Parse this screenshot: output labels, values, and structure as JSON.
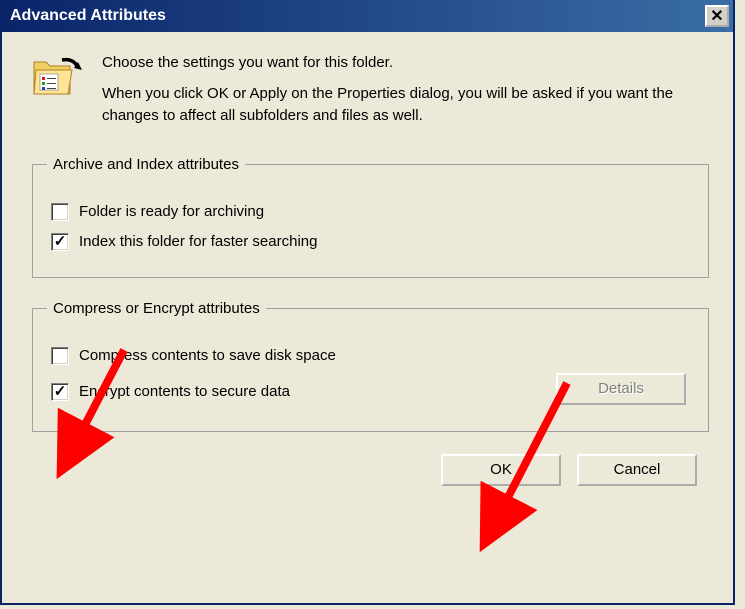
{
  "window": {
    "title": "Advanced Attributes"
  },
  "header": {
    "line1": "Choose the settings you want for this folder.",
    "line2": "When you click OK or Apply on the Properties dialog, you will be asked if you want the changes to affect all subfolders and files as well."
  },
  "groups": {
    "archive": {
      "legend": "Archive and Index attributes",
      "items": [
        {
          "label": "Folder is ready for archiving",
          "checked": false
        },
        {
          "label": "Index this folder for faster searching",
          "checked": true
        }
      ]
    },
    "compress": {
      "legend": "Compress or Encrypt attributes",
      "items": [
        {
          "label": "Compress contents to save disk space",
          "checked": false
        },
        {
          "label": "Encrypt contents to secure data",
          "checked": true
        }
      ],
      "details_label": "Details"
    }
  },
  "buttons": {
    "ok": "OK",
    "cancel": "Cancel"
  }
}
